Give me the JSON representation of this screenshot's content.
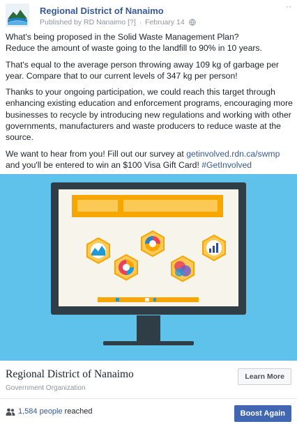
{
  "post": {
    "page_name": "Regional District of Nanaimo",
    "published_by": "Published by RD Nanaimo",
    "publisher_marker": "[?]",
    "separator": "·",
    "date": "February 14",
    "privacy_icon": "globe-icon",
    "more_icon": "more-options-icon",
    "paragraphs": [
      {
        "line1": "What's being proposed in the Solid Waste Management Plan?",
        "line2": "Reduce the amount of waste going to the landfill to 90% in 10 years."
      },
      {
        "text": "That's equal to the average person throwing away 109 kg of garbage per year. Compare that to our current levels of 347 kg per person!"
      },
      {
        "text": "Thanks to your ongoing participation, we could reach this target through enhancing existing education and enforcement programs, encouraging more businesses to recycle by introducing new regulations and working with other governments, manufacturers and waste producers to reduce waste at the source."
      },
      {
        "before": "We want to hear from you! Fill out our survey at ",
        "link": "getinvolved.rdn.ca/swmp",
        "middle": " and you'll be entered to win an $100 Visa Gift Card! ",
        "hashtag": "#GetInvolved"
      }
    ]
  },
  "preview": {
    "org_name": "Regional District of Nanaimo",
    "org_type": "Government Organization",
    "cta_label": "Learn More"
  },
  "footer": {
    "reach_count": "1,584 people",
    "reach_label": " reached",
    "people_icon": "people-icon",
    "boost_label": "Boost Again"
  },
  "colors": {
    "link": "#365899",
    "boost_button": "#4267b2",
    "image_background": "#5fc2ea",
    "accent_orange": "#f7a600"
  }
}
